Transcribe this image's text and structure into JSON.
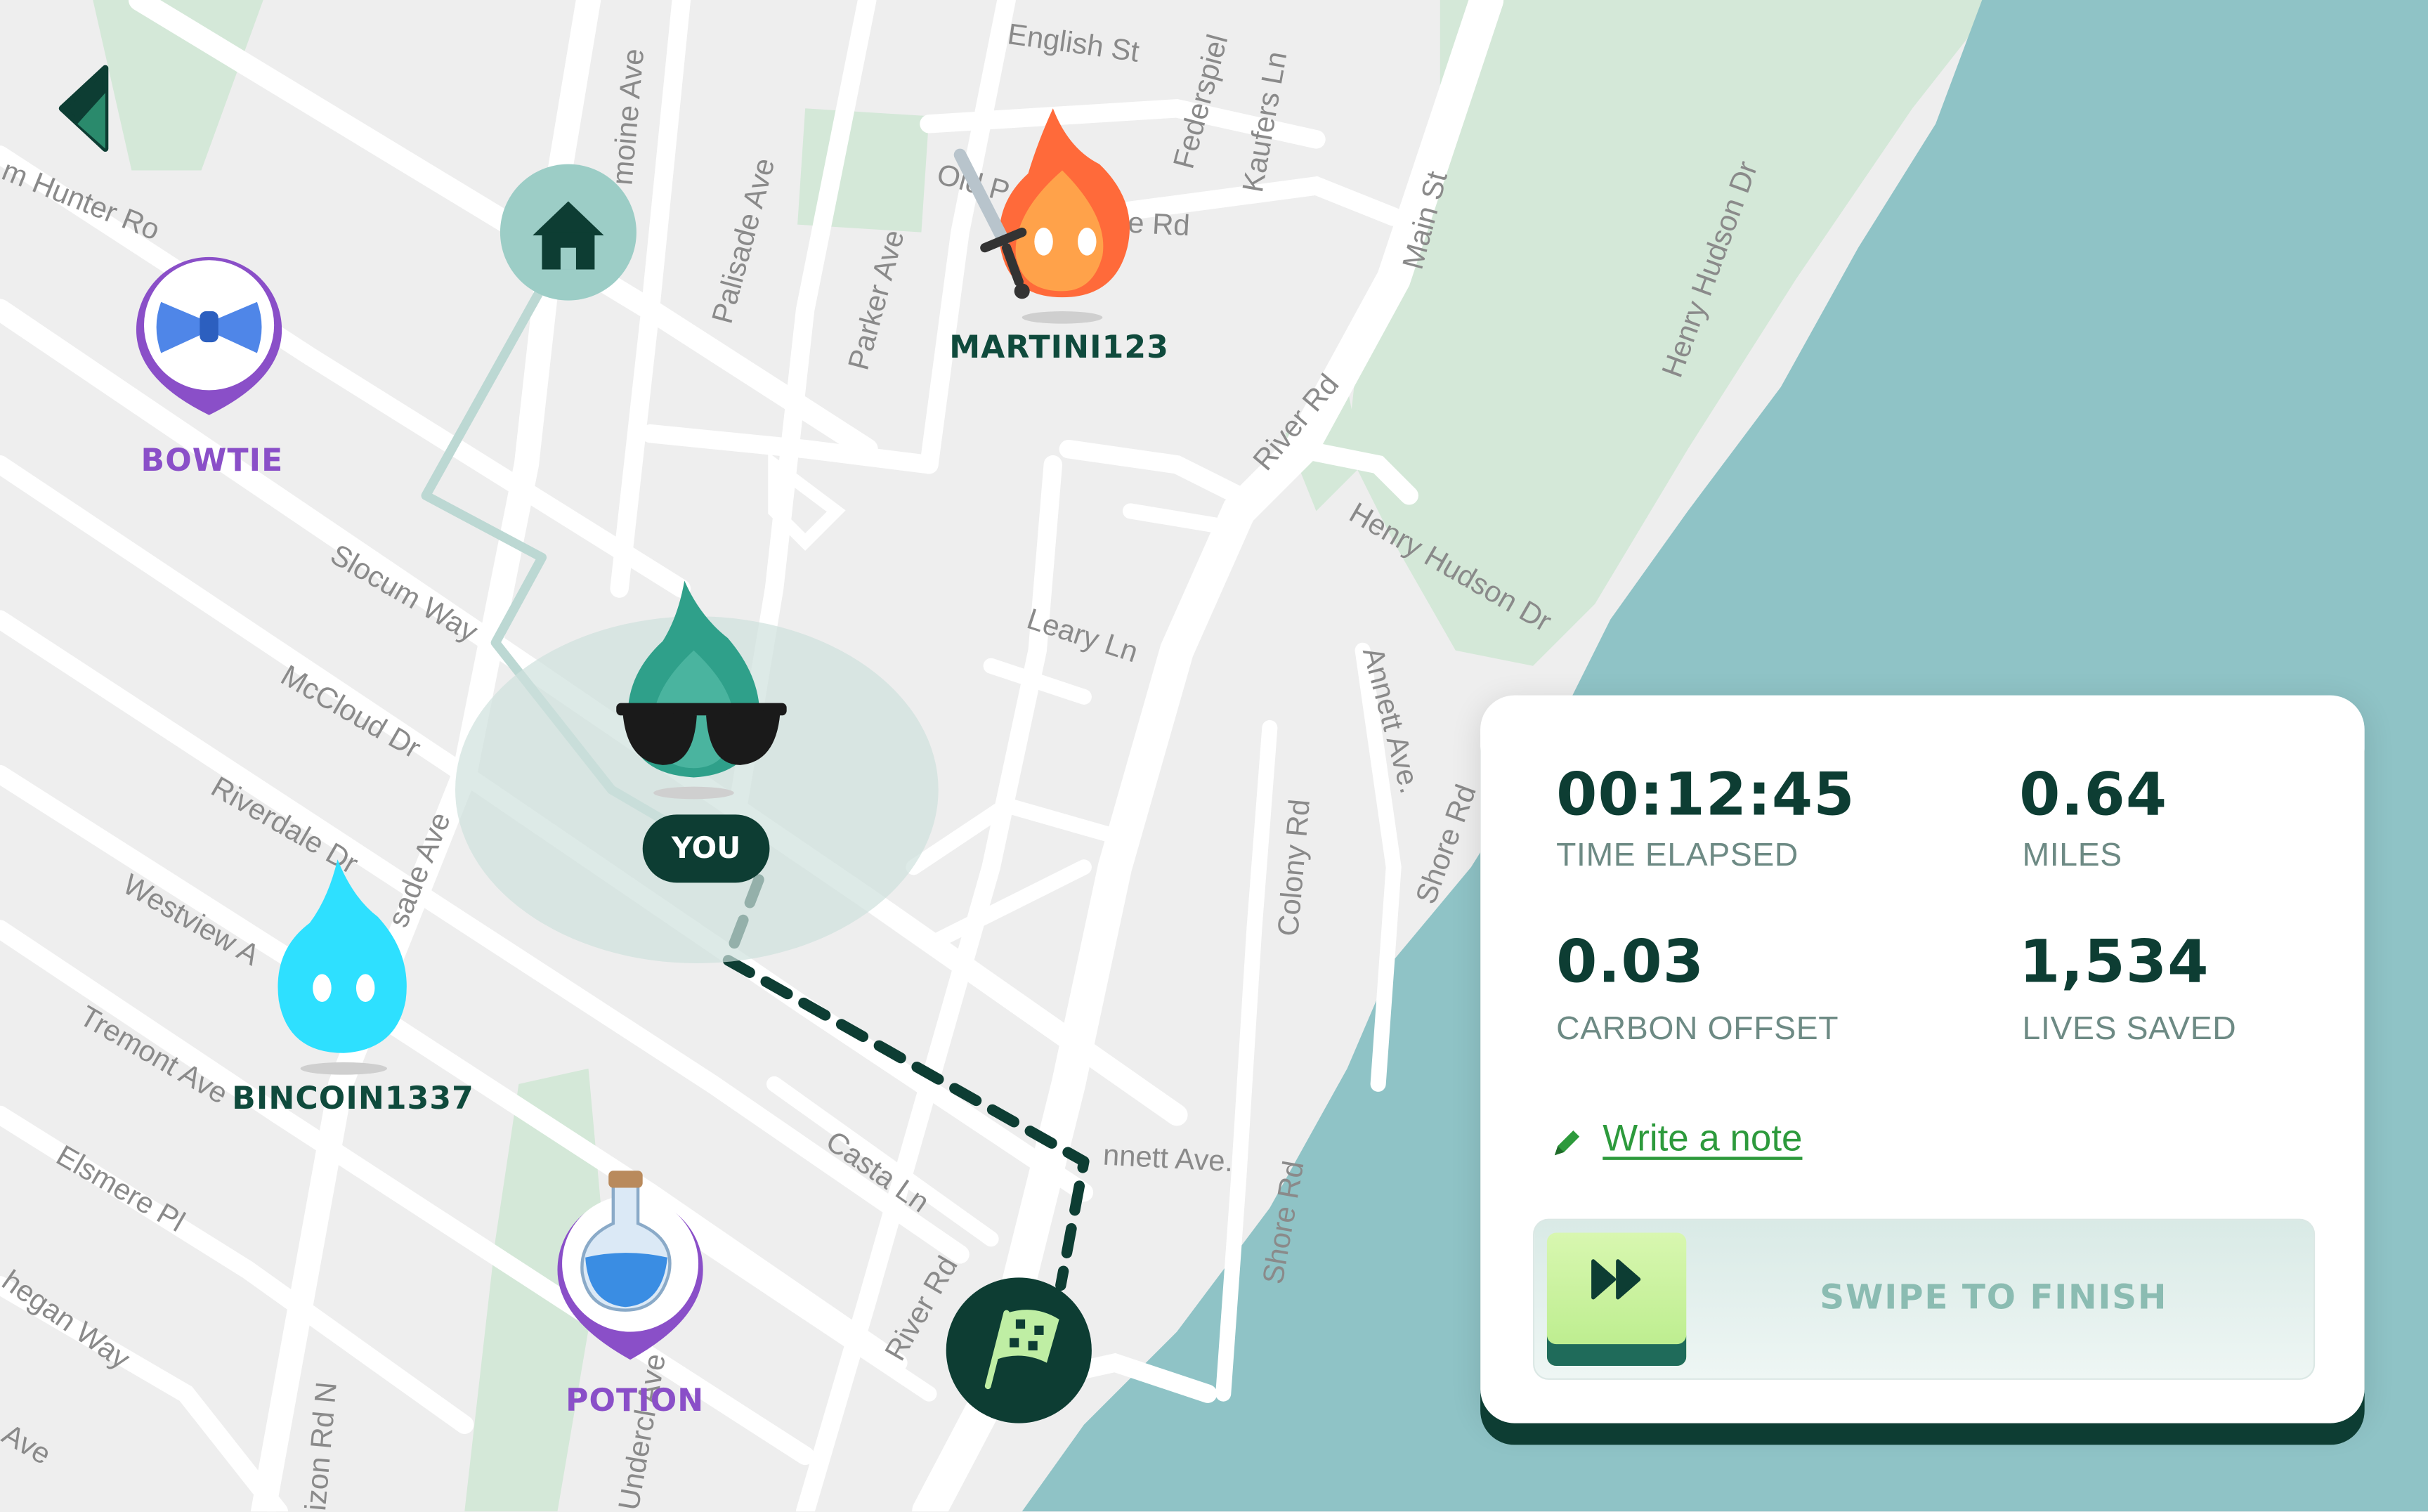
{
  "map": {
    "streets": [
      "English St",
      "Federspiel",
      "Kaufers Ln",
      "Main St",
      "Henry Hudson Dr",
      "Old P",
      "e Rd",
      "Palisade Ave",
      "Parker Ave",
      "moine Ave",
      "m Hunter Ro",
      "River Rd",
      "Henry Hudson Dr",
      "Slocum Way",
      "Leary Ln",
      "McCloud Dr",
      "Annett Ave.",
      "Colony Rd",
      "Shore Rd",
      "Riverdale Dr",
      "sade Ave",
      "Westview A",
      "Tremont Ave",
      "nnett Ave.",
      "Casta Ln",
      "Shore Rd",
      "Elsmere Pl",
      "River Rd",
      "hegan Way",
      "izon Rd N",
      "Undercl Ave",
      "Ave"
    ],
    "colors": {
      "land": "#eeeeee",
      "road": "#ffffff",
      "park": "#d4e8d8",
      "water": "#8fc3c6",
      "route": "#0d3d33"
    }
  },
  "markers": {
    "home": {
      "icon": "home-icon"
    },
    "finish": {
      "icon": "checkered-flag-icon"
    },
    "bowtie": {
      "label": "BOWTIE",
      "icon": "bowtie-icon"
    },
    "potion": {
      "label": "POTION",
      "icon": "potion-icon"
    },
    "martini": {
      "label": "MARTINI123",
      "icon": "fire-sword-avatar-icon"
    },
    "bincoin": {
      "label": "BINCOIN1337",
      "icon": "blue-flame-avatar-icon"
    },
    "you": {
      "label": "YOU",
      "icon": "green-flame-sunglasses-avatar-icon"
    }
  },
  "stats_card": {
    "time_value": "00:12:45",
    "time_label": "TIME ELAPSED",
    "miles_value": "0.64",
    "miles_label": "MILES",
    "carbon_value": "0.03",
    "carbon_label": "CARBON OFFSET",
    "lives_value": "1,534",
    "lives_label": "LIVES SAVED",
    "note_link": "Write a note",
    "swipe_label": "SWIPE TO FINISH"
  }
}
